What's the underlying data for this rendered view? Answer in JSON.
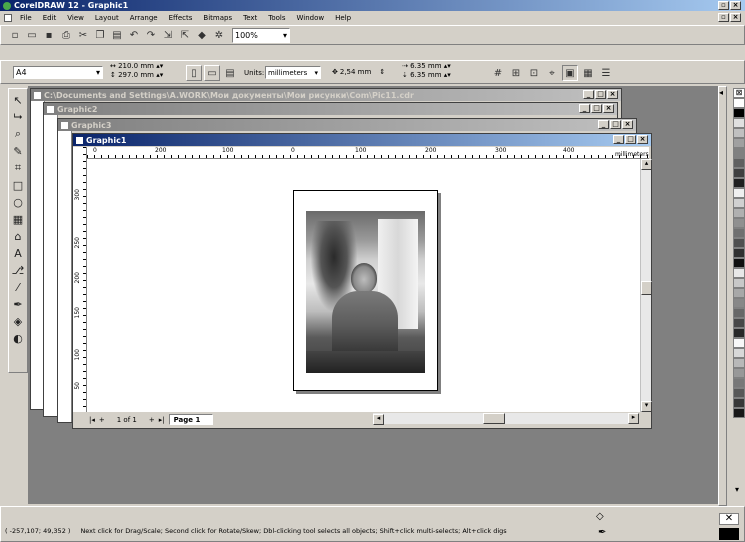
{
  "app": {
    "title": "CorelDRAW 12 - Graphic1",
    "menu": [
      "File",
      "Edit",
      "View",
      "Layout",
      "Arrange",
      "Effects",
      "Bitmaps",
      "Text",
      "Tools",
      "Window",
      "Help"
    ],
    "zoom": "100%",
    "page_size": "A4",
    "width": "210.0 mm",
    "height": "297.0 mm",
    "units_label": "Units:",
    "units_value": "millimeters",
    "nudge": "2,54 mm",
    "dup_x": "6.35 mm",
    "dup_y": "6.35 mm"
  },
  "windows": [
    {
      "title": "C:\\Documents and Settings\\A.WORK\\Мои документы\\Мои рисунки\\Com\\Pic11.cdr"
    },
    {
      "title": "Graphic2"
    },
    {
      "title": "Graphic3"
    },
    {
      "title": "Graphic1"
    }
  ],
  "ruler": {
    "h_ticks": [
      "0",
      "200",
      "100",
      "0",
      "100",
      "200",
      "300",
      "400"
    ],
    "units": "millimeters",
    "v_ticks": [
      "300",
      "250",
      "200",
      "150",
      "100",
      "50"
    ],
    "v_units": "millimeters"
  },
  "page_nav": {
    "counter": "1 of 1",
    "tab": "Page 1"
  },
  "status": {
    "coords": "( -257,107; 49,352 )",
    "message": "Next click for Drag/Scale; Second click for Rotate/Skew; Dbl-clicking tool selects all objects; Shift+click multi-selects; Alt+click digs"
  },
  "palette": [
    "#ffffff",
    "#000000",
    "#e0e0e0",
    "#c0c0c0",
    "#a0a0a0",
    "#808080",
    "#606060",
    "#404040",
    "#202020",
    "#f0f0f0",
    "#d0d0d0",
    "#b0b0b0",
    "#909090",
    "#707070",
    "#505050",
    "#303030",
    "#101010",
    "#e8e8e8",
    "#c8c8c8",
    "#a8a8a8",
    "#888888",
    "#686868",
    "#484848",
    "#282828",
    "#f8f8f8",
    "#d8d8d8",
    "#b8b8b8",
    "#989898",
    "#787878",
    "#585858",
    "#383838",
    "#181818"
  ],
  "icons": {
    "app": "coreldraw-icon",
    "tools": [
      "pick-tool-icon",
      "shape-tool-icon",
      "zoom-tool-icon",
      "freehand-tool-icon",
      "smart-fill-icon",
      "rectangle-tool-icon",
      "ellipse-tool-icon",
      "polygon-tool-icon",
      "basic-shapes-icon",
      "text-tool-icon",
      "interactive-blend-icon",
      "eyedropper-icon",
      "outline-tool-icon",
      "fill-tool-icon",
      "interactive-fill-icon"
    ]
  }
}
